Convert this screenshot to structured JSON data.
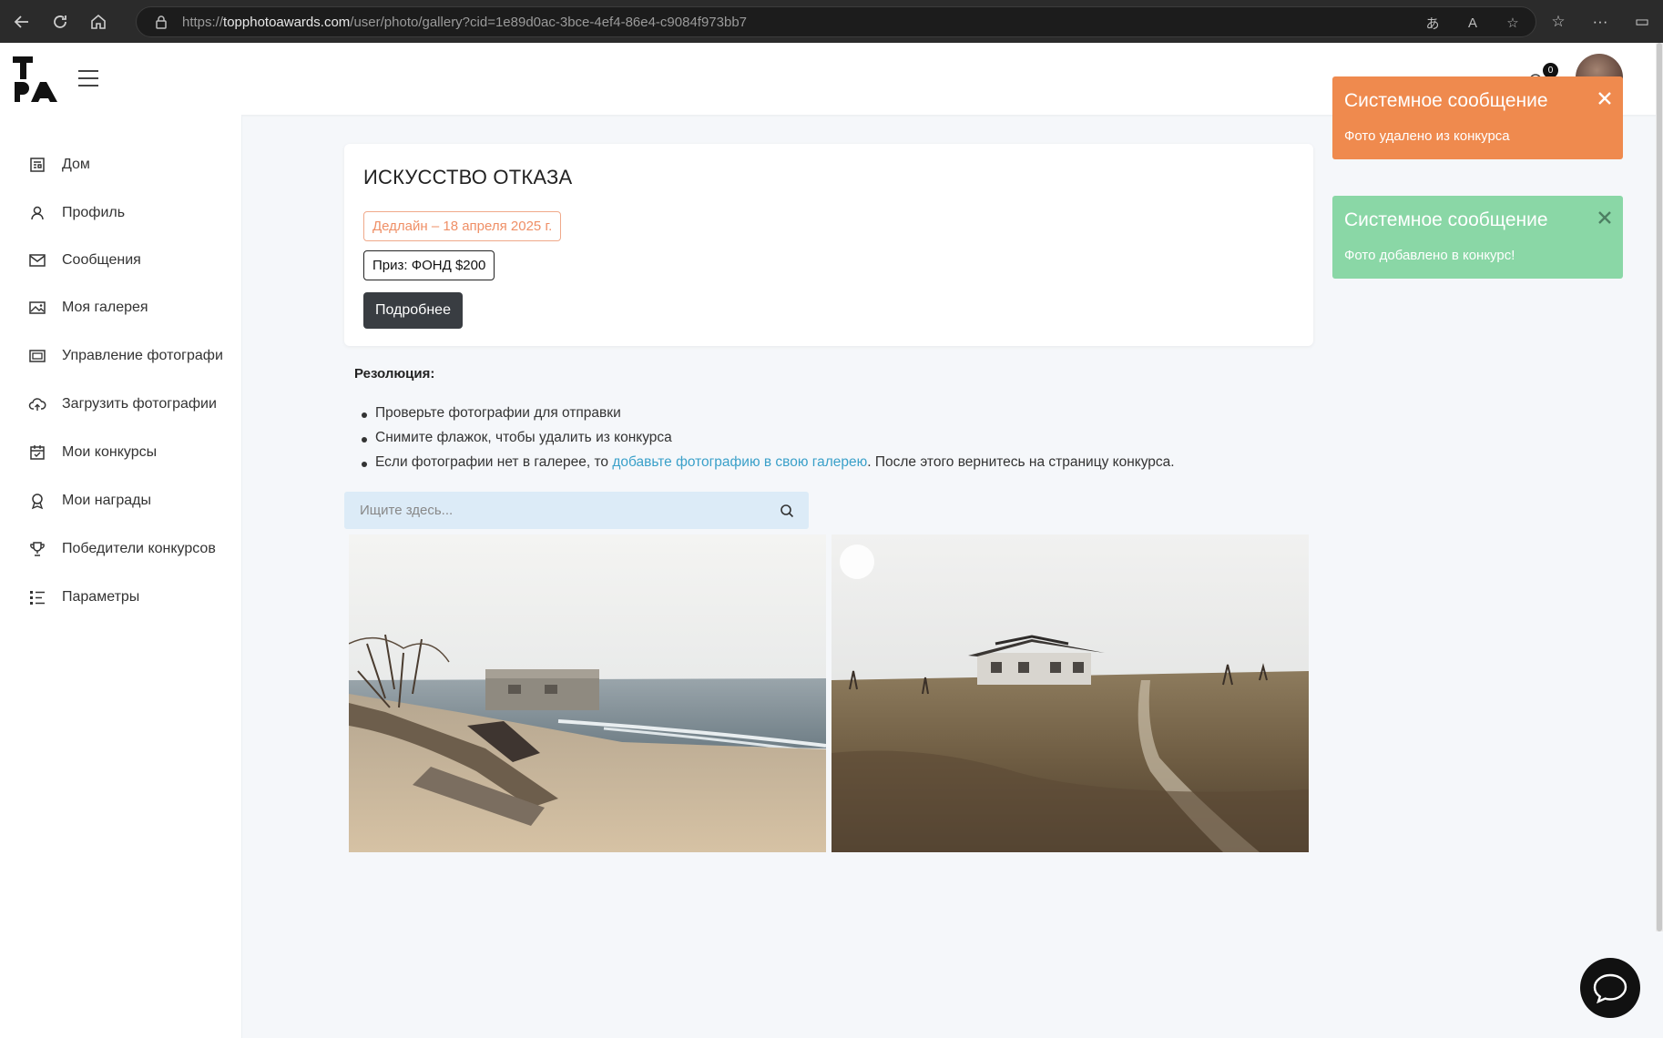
{
  "browser": {
    "url_prefix": "https://",
    "url_host": "topphotoawards.com",
    "url_path": "/user/photo/gallery?cid=1e89d0ac-3bce-4ef4-86e4-c9084f973bb7"
  },
  "header": {
    "logo_icon": "tpa-logo",
    "menu_icon": "hamburger-icon",
    "notification_count": "0"
  },
  "sidebar": {
    "items": [
      {
        "label": "Дом",
        "icon": "home-icon"
      },
      {
        "label": "Профиль",
        "icon": "user-icon"
      },
      {
        "label": "Сообщения",
        "icon": "mail-icon"
      },
      {
        "label": "Моя галерея",
        "icon": "image-icon"
      },
      {
        "label": "Управление фотографи",
        "icon": "photos-icon"
      },
      {
        "label": "Загрузить фотографии",
        "icon": "cloud-upload-icon"
      },
      {
        "label": "Мои конкурсы",
        "icon": "calendar-check-icon"
      },
      {
        "label": "Мои награды",
        "icon": "award-icon"
      },
      {
        "label": "Победители конкурсов",
        "icon": "trophy-icon"
      },
      {
        "label": "Параметры",
        "icon": "settings-list-icon"
      }
    ]
  },
  "contest": {
    "title": "ИСКУССТВО ОТКАЗА",
    "deadline": "Дедлайн – 18 апреля 2025 г.",
    "prize": "Приз: ФОНД $200",
    "more_button": "Подробнее"
  },
  "resolution": {
    "title": "Резолюция:",
    "items": [
      "Проверьте фотографии для отправки",
      "Снимите флажок, чтобы удалить из конкурса"
    ],
    "item3_before": "Если фотографии нет в галерее, то ",
    "item3_link": "добавьте фотографию в свою галерею",
    "item3_after": ". После этого вернитесь на страницу конкурса."
  },
  "search": {
    "placeholder": "Ищите здесь..."
  },
  "toasts": [
    {
      "title": "Системное сообщение",
      "message": "Фото удалено из конкурса",
      "color": "#ef8a4e"
    },
    {
      "title": "Системное сообщение",
      "message": "Фото добавлено в конкурс!",
      "color": "#8ad7a6"
    }
  ],
  "colors": {
    "accent_link": "#3aa0c9",
    "dark_button": "#393d42",
    "deadline": "#ef8f66"
  }
}
